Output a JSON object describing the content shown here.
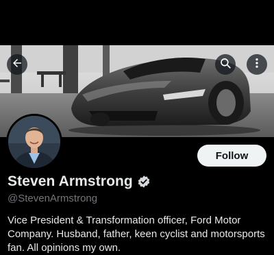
{
  "profile": {
    "display_name": "Steven Armstrong",
    "handle": "@StevenArmstrong",
    "bio": "Vice President & Transformation officer, Ford Motor Company. Husband, father, keen cyclist and motorsports fan. All opinions my own.",
    "verified": true
  },
  "actions": {
    "follow_label": "Follow"
  },
  "icons": {
    "back": "arrow-left-icon",
    "search": "search-icon",
    "more": "more-vertical-icon",
    "verified": "verified-badge-icon"
  },
  "colors": {
    "background": "#000000",
    "text_primary": "#e7e9ea",
    "text_secondary": "#71767b",
    "follow_bg": "#eff3f4",
    "follow_text": "#0f1419"
  }
}
